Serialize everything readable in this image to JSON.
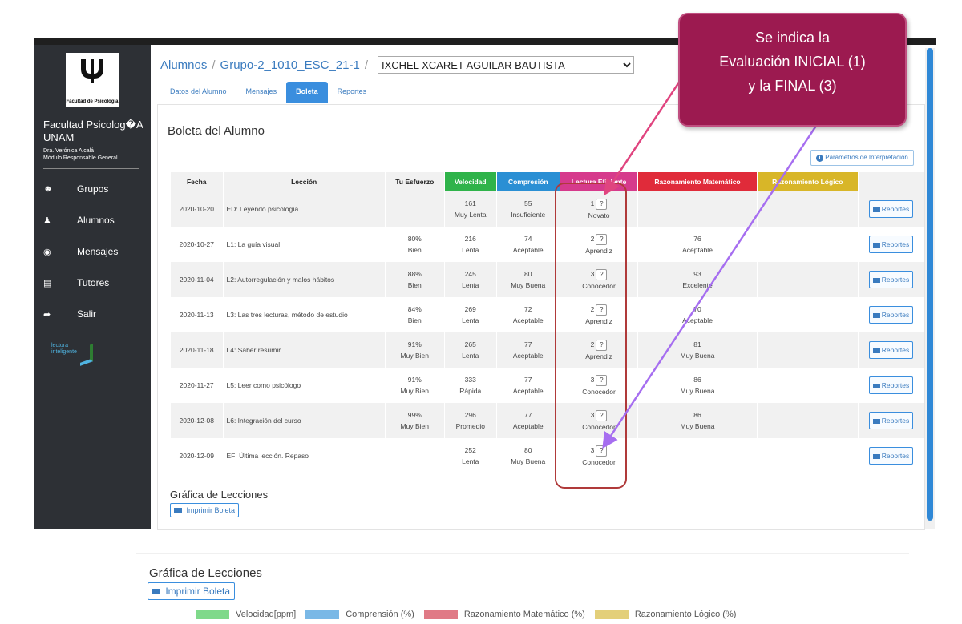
{
  "sidebar": {
    "logo_text": "Facultad de Psicología",
    "faculty_name": "Facultad Psicolog�A UNAM",
    "user_name": "Dra. Verónica Alcalá",
    "user_role": "Módulo Responsable General",
    "items": [
      {
        "label": "Grupos",
        "icon": "users-icon"
      },
      {
        "label": "Alumnos",
        "icon": "user-icon"
      },
      {
        "label": "Mensajes",
        "icon": "comments-icon"
      },
      {
        "label": "Tutores",
        "icon": "tutor-icon"
      },
      {
        "label": "Salir",
        "icon": "logout-icon"
      }
    ],
    "brand_text": "lectura inteligente"
  },
  "breadcrumb": {
    "root": "Alumnos",
    "group": "Grupo-2_1010_ESC_21-1",
    "student": "IXCHEL XCARET AGUILAR BAUTISTA"
  },
  "tabs": [
    "Datos del Alumno",
    "Mensajes",
    "Boleta",
    "Reportes"
  ],
  "active_tab": "Boleta",
  "panel": {
    "title": "Boleta del Alumno",
    "params_button": "Parámetros de Interpretación"
  },
  "table": {
    "headers": [
      "Fecha",
      "Lección",
      "Tu Esfuerzo",
      "Velocidad",
      "Compresión",
      "Lectura Eficiente",
      "Razonamiento Matemático",
      "Razonamiento Lógico",
      ""
    ],
    "header_colors": [
      "#f1f1f1",
      "#f1f1f1",
      "#f1f1f1",
      "#2fb34a",
      "#2a8fd4",
      "#d63a8c",
      "#e02b3a",
      "#d8b628",
      "#f1f1f1"
    ],
    "rows": [
      {
        "fecha": "2020-10-20",
        "leccion": "ED: Leyendo psicología",
        "esfuerzo_pct": "",
        "esfuerzo_txt": "",
        "vel_num": "161",
        "vel_txt": "Muy Lenta",
        "comp_num": "55",
        "comp_txt": "Insuficiente",
        "le_num": "1",
        "le_txt": "Novato",
        "rm_num": "",
        "rm_txt": "",
        "btn": "Reportes"
      },
      {
        "fecha": "2020-10-27",
        "leccion": "L1: La guía visual",
        "esfuerzo_pct": "80%",
        "esfuerzo_txt": "Bien",
        "vel_num": "216",
        "vel_txt": "Lenta",
        "comp_num": "74",
        "comp_txt": "Aceptable",
        "le_num": "2",
        "le_txt": "Aprendiz",
        "rm_num": "76",
        "rm_txt": "Aceptable",
        "btn": "Reportes"
      },
      {
        "fecha": "2020-11-04",
        "leccion": "L2: Autorregulación y malos hábitos",
        "esfuerzo_pct": "88%",
        "esfuerzo_txt": "Bien",
        "vel_num": "245",
        "vel_txt": "Lenta",
        "comp_num": "80",
        "comp_txt": "Muy Buena",
        "le_num": "3",
        "le_txt": "Conocedor",
        "rm_num": "93",
        "rm_txt": "Excelente",
        "btn": "Reportes"
      },
      {
        "fecha": "2020-11-13",
        "leccion": "L3: Las tres lecturas, método de estudio",
        "esfuerzo_pct": "84%",
        "esfuerzo_txt": "Bien",
        "vel_num": "269",
        "vel_txt": "Lenta",
        "comp_num": "72",
        "comp_txt": "Aceptable",
        "le_num": "2",
        "le_txt": "Aprendiz",
        "rm_num": "70",
        "rm_txt": "Aceptable",
        "btn": "Reportes"
      },
      {
        "fecha": "2020-11-18",
        "leccion": "L4: Saber resumir",
        "esfuerzo_pct": "91%",
        "esfuerzo_txt": "Muy Bien",
        "vel_num": "265",
        "vel_txt": "Lenta",
        "comp_num": "77",
        "comp_txt": "Aceptable",
        "le_num": "2",
        "le_txt": "Aprendiz",
        "rm_num": "81",
        "rm_txt": "Muy Buena",
        "btn": "Reportes"
      },
      {
        "fecha": "2020-11-27",
        "leccion": "L5: Leer como psicólogo",
        "esfuerzo_pct": "91%",
        "esfuerzo_txt": "Muy Bien",
        "vel_num": "333",
        "vel_txt": "Rápida",
        "comp_num": "77",
        "comp_txt": "Aceptable",
        "le_num": "3",
        "le_txt": "Conocedor",
        "rm_num": "86",
        "rm_txt": "Muy Buena",
        "btn": "Reportes"
      },
      {
        "fecha": "2020-12-08",
        "leccion": "L6: Integración del curso",
        "esfuerzo_pct": "99%",
        "esfuerzo_txt": "Muy Bien",
        "vel_num": "296",
        "vel_txt": "Promedio",
        "comp_num": "77",
        "comp_txt": "Aceptable",
        "le_num": "3",
        "le_txt": "Conocedor",
        "rm_num": "86",
        "rm_txt": "Muy Buena",
        "btn": "Reportes"
      },
      {
        "fecha": "2020-12-09",
        "leccion": "EF: Última lección. Repaso",
        "esfuerzo_pct": "",
        "esfuerzo_txt": "",
        "vel_num": "252",
        "vel_txt": "Lenta",
        "comp_num": "80",
        "comp_txt": "Muy Buena",
        "le_num": "3",
        "le_txt": "Conocedor",
        "rm_num": "",
        "rm_txt": "",
        "btn": "Reportes"
      }
    ],
    "qmark": "?"
  },
  "grafica_small": {
    "title": "Gráfica de Lecciones",
    "print_label": "Imprimir Boleta"
  },
  "callout": {
    "line1": "Se indica la",
    "line2": "Evaluación INICIAL (1)",
    "line3": "y la FINAL (3)"
  },
  "grafica_big": {
    "title": "Gráfica de Lecciones",
    "print_label": "Imprimir Boleta",
    "legend": [
      {
        "label": "Velocidad[ppm]",
        "color": "#7fd98a"
      },
      {
        "label": "Comprensión (%)",
        "color": "#7ab8e6"
      },
      {
        "label": "Razonamiento Matemático (%)",
        "color": "#e07a86"
      },
      {
        "label": "Razonamiento Lógico (%)",
        "color": "#e3cf7a"
      }
    ]
  }
}
